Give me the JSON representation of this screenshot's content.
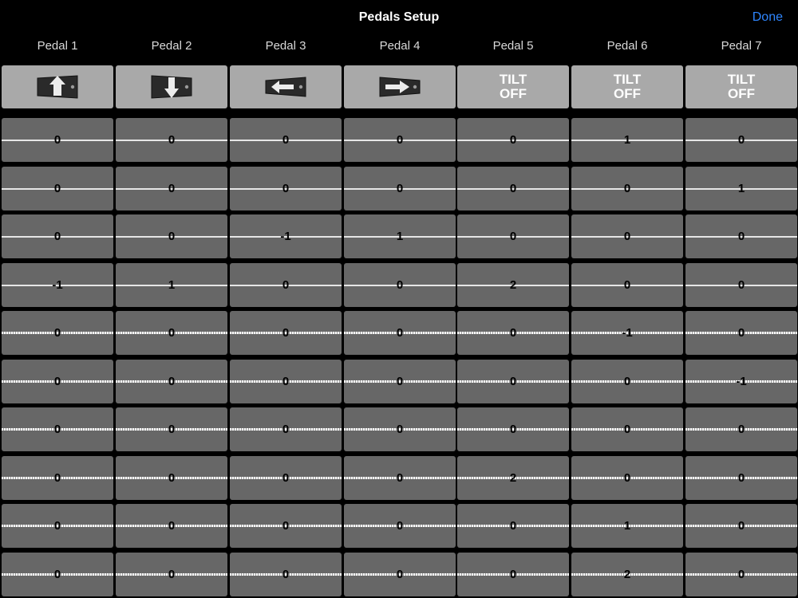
{
  "nav": {
    "title": "Pedals Setup",
    "done_label": "Done"
  },
  "colors": {
    "background": "#000000",
    "accent": "#2f86ff",
    "cell": "#676767",
    "tilt_button": "#a9a9a9"
  },
  "pedals": [
    {
      "label": "Pedal 1",
      "tilt": {
        "type": "icon",
        "icon": "tilt-up-icon"
      }
    },
    {
      "label": "Pedal 2",
      "tilt": {
        "type": "icon",
        "icon": "tilt-down-icon"
      }
    },
    {
      "label": "Pedal 3",
      "tilt": {
        "type": "icon",
        "icon": "tilt-left-icon"
      }
    },
    {
      "label": "Pedal 4",
      "tilt": {
        "type": "icon",
        "icon": "tilt-right-icon"
      }
    },
    {
      "label": "Pedal 5",
      "tilt": {
        "type": "text",
        "text": "TILT\nOFF"
      }
    },
    {
      "label": "Pedal 6",
      "tilt": {
        "type": "text",
        "text": "TILT\nOFF"
      }
    },
    {
      "label": "Pedal 7",
      "tilt": {
        "type": "text",
        "text": "TILT\nOFF"
      }
    }
  ],
  "grid": {
    "rows": [
      [
        "0",
        "0",
        "0",
        "0",
        "0",
        "1",
        "0"
      ],
      [
        "0",
        "0",
        "0",
        "0",
        "0",
        "0",
        "1"
      ],
      [
        "0",
        "0",
        "-1",
        "1",
        "0",
        "0",
        "0"
      ],
      [
        "-1",
        "1",
        "0",
        "0",
        "2",
        "0",
        "0"
      ],
      [
        "0",
        "0",
        "0",
        "0",
        "0",
        "-1",
        "0"
      ],
      [
        "0",
        "0",
        "0",
        "0",
        "0",
        "0",
        "-1"
      ],
      [
        "0",
        "0",
        "0",
        "0",
        "0",
        "0",
        "0"
      ],
      [
        "0",
        "0",
        "0",
        "0",
        "2",
        "0",
        "0"
      ],
      [
        "0",
        "0",
        "0",
        "0",
        "0",
        "1",
        "0"
      ],
      [
        "0",
        "0",
        "0",
        "0",
        "0",
        "2",
        "0"
      ]
    ]
  }
}
